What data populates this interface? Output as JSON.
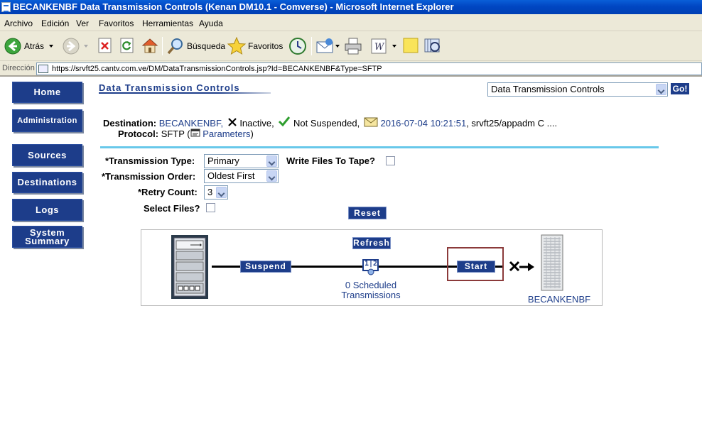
{
  "window": {
    "title": "BECANKENBF Data Transmission Controls (Kenan DM10.1 - Comverse) - Microsoft Internet Explorer"
  },
  "menu": [
    "Archivo",
    "Edición",
    "Ver",
    "Favoritos",
    "Herramientas",
    "Ayuda"
  ],
  "toolbar": {
    "back_label": "Atrás",
    "search_label": "Búsqueda",
    "favorites_label": "Favoritos"
  },
  "address": {
    "label": "Dirección",
    "url": "https://srvft25.cantv.com.ve/DM/DataTransmissionControls.jsp?Id=BECANKENBF&Type=SFTP"
  },
  "nav": {
    "home": "Home",
    "administration": "Administration",
    "sources": "Sources",
    "destinations": "Destinations",
    "logs": "Logs",
    "system_summary_1": "System",
    "system_summary_2": "Summary"
  },
  "page": {
    "title": "Data Transmission Controls",
    "page_select": "Data Transmission Controls",
    "go": "Go!"
  },
  "destination": {
    "label": "Destination:",
    "name": "BECANKENBF,",
    "status": "Inactive,",
    "suspended": "Not Suspended,",
    "timestamp": "2016-07-04 10:21:51",
    "host": ", srvft25/appadm C ...."
  },
  "protocol": {
    "label": "Protocol:",
    "value": "SFTP (",
    "link": "Parameters",
    "close": ")"
  },
  "form": {
    "transmission_type_label": "*Transmission Type:",
    "transmission_type_value": "Primary",
    "write_files_label": "Write Files To Tape?",
    "transmission_order_label": "*Transmission Order:",
    "transmission_order_value": "Oldest First",
    "retry_count_label": "*Retry Count:",
    "retry_count_value": "3",
    "select_files_label": "Select Files?",
    "reset": "Reset"
  },
  "diagram": {
    "suspend": "Suspend",
    "refresh": "Refresh",
    "start": "Start",
    "scheduled_1": "0 Scheduled",
    "scheduled_2": "Transmissions",
    "queue_icon_text": "1|2",
    "destination_name": "BECANKENBF"
  },
  "colors": {
    "nav_button": "#1d3d8a",
    "divider": "#68c8ea",
    "start_highlight": "#8b3a3a",
    "check": "#2f9e2f"
  }
}
